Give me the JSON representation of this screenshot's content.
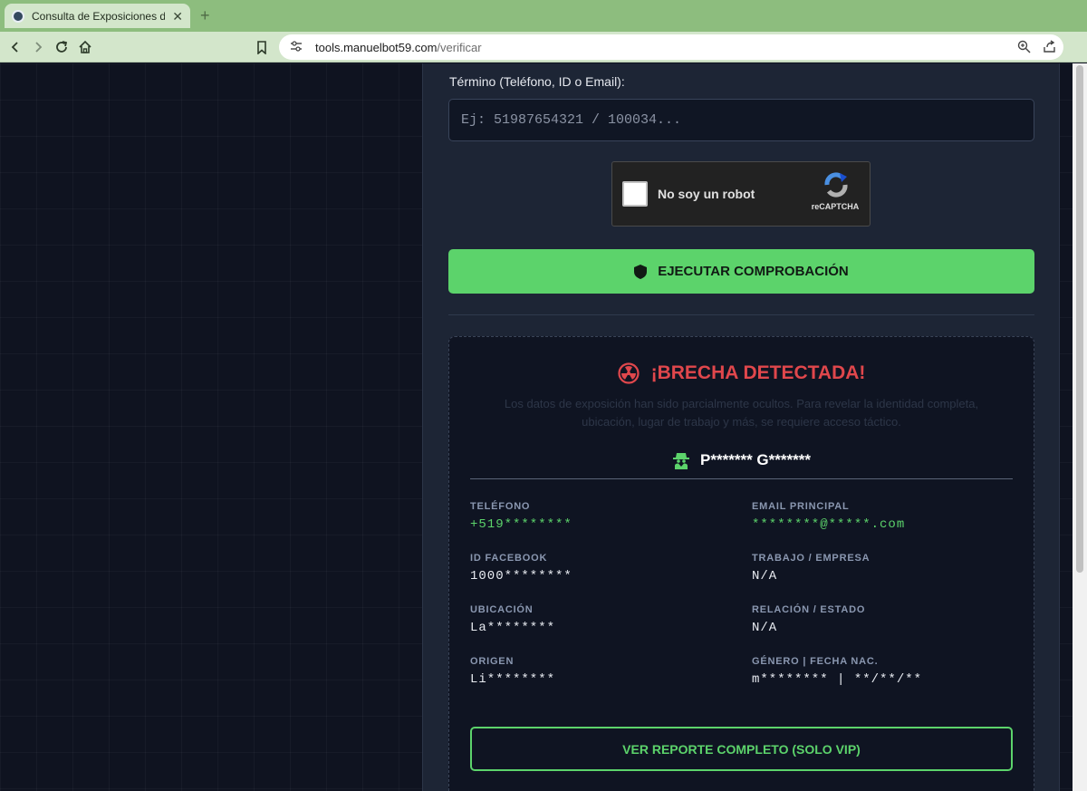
{
  "browser": {
    "tab_title": "Consulta de Exposiciones de dat",
    "tab_close": "✕",
    "new_tab": "+",
    "url_host": "tools.manuelbot59.com",
    "url_path": "/verificar"
  },
  "form": {
    "term_label": "Término (Teléfono, ID o Email):",
    "term_placeholder": "Ej: 51987654321 / 100034...",
    "captcha_text": "No soy un robot",
    "captcha_brand": "reCAPTCHA",
    "submit_label": "EJECUTAR COMPROBACIÓN"
  },
  "result": {
    "title": "¡BRECHA DETECTADA!",
    "message": "Los datos de exposición han sido parcialmente ocultos. Para revelar la identidad completa, ubicación, lugar de trabajo y más, se requiere acceso táctico.",
    "target_name": "P******* G*******",
    "fields": [
      {
        "label": "TELÉFONO",
        "value": "+519********",
        "highlight": true
      },
      {
        "label": "EMAIL PRINCIPAL",
        "value": "********@*****.com",
        "highlight": true
      },
      {
        "label": "ID FACEBOOK",
        "value": "1000********",
        "highlight": false
      },
      {
        "label": "TRABAJO / EMPRESA",
        "value": "N/A",
        "highlight": false
      },
      {
        "label": "UBICACIÓN",
        "value": "La********",
        "highlight": false
      },
      {
        "label": "RELACIÓN / ESTADO",
        "value": "N/A",
        "highlight": false
      },
      {
        "label": "ORIGEN",
        "value": "Li********",
        "highlight": false
      },
      {
        "label": "GÉNERO | FECHA NAC.",
        "value": "m******** | **/**/**",
        "highlight": false
      }
    ],
    "vip_label": "VER REPORTE COMPLETO (SOLO VIP)"
  },
  "colors": {
    "accent_green": "#5cd36b",
    "alert_red": "#e0474c",
    "panel_bg": "#1d2535",
    "page_bg": "#0f1320"
  }
}
